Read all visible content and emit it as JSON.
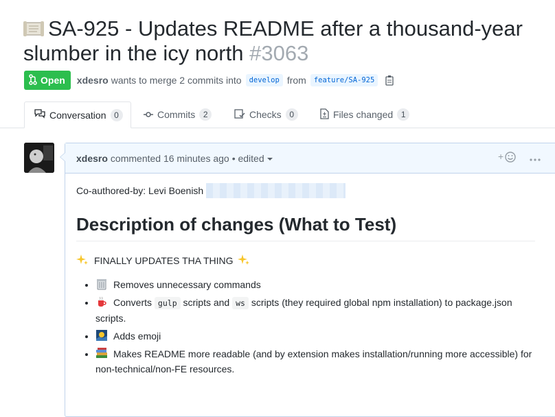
{
  "pr": {
    "title": "SA-925 - Updates README after a thousand-year slumber in the icy north",
    "number": "#3063",
    "state": "Open",
    "author": "xdesro",
    "merge_text": "wants to merge 2 commits into",
    "base_branch": "develop",
    "from_text": "from",
    "head_branch": "feature/SA-925"
  },
  "tabs": [
    {
      "label": "Conversation",
      "count": "0"
    },
    {
      "label": "Commits",
      "count": "2"
    },
    {
      "label": "Checks",
      "count": "0"
    },
    {
      "label": "Files changed",
      "count": "1"
    }
  ],
  "comment": {
    "user": "xdesro",
    "action": "commented 16 minutes ago",
    "edited": "• edited",
    "coauthor": "Co-authored-by: Levi Boenish",
    "heading": "Description of changes (What to Test)",
    "intro": "FINALLY UPDATES THA THING",
    "items": [
      {
        "emoji": "wastebasket-icon",
        "text": "Removes unnecessary commands"
      },
      {
        "emoji": "cup-icon",
        "pre": "Converts",
        "code1": "gulp",
        "mid": "scripts and",
        "code2": "ws",
        "post": "scripts (they required global npm installation) to package.json scripts."
      },
      {
        "emoji": "picture-icon",
        "text": "Adds emoji"
      },
      {
        "emoji": "books-icon",
        "text": "Makes README more readable (and by extension makes installation/running more accessible) for non-technical/non-FE resources."
      }
    ]
  },
  "colors": {
    "open_green": "#2cbe4e",
    "link_blue": "#0366d6",
    "header_blue": "#f1f8ff"
  }
}
